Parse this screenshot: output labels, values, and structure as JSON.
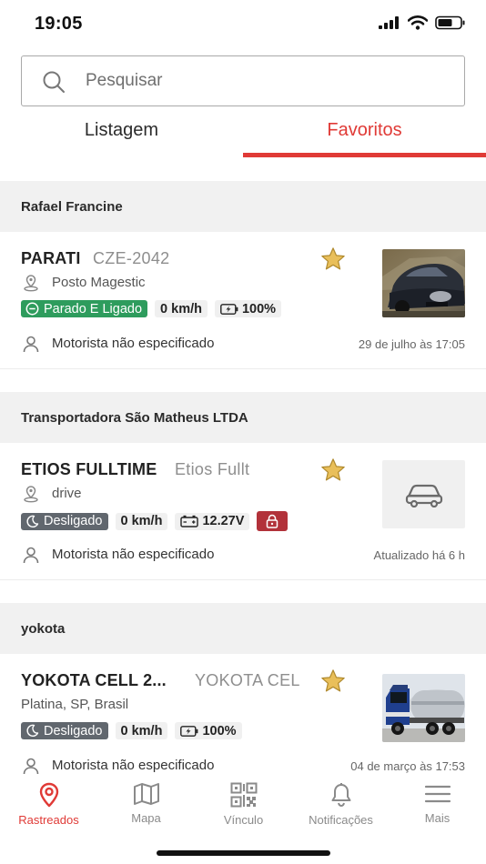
{
  "status_bar": {
    "time": "19:05"
  },
  "search": {
    "placeholder": "Pesquisar",
    "value": ""
  },
  "tabs": [
    {
      "label": "Listagem",
      "active": false
    },
    {
      "label": "Favoritos",
      "active": true
    }
  ],
  "colors": {
    "accent": "#e03a36",
    "status_on": "#2e9c5d",
    "status_off": "#61676e",
    "lock": "#b2323a",
    "star": "#e9bf5a"
  },
  "groups": [
    {
      "name": "Rafael Francine",
      "vehicle": {
        "name": "PARATI",
        "plate": "CZE-2042",
        "favorite": true,
        "location": "Posto Magestic",
        "status": "Parado E Ligado",
        "status_icon": "minus-circle-icon",
        "speed": "0 km/h",
        "power_icon": "battery-charge-icon",
        "power": "100%",
        "locked": false,
        "driver": "Motorista não especificado",
        "timestamp": "29 de julho às 17:05",
        "thumbnail": "car-photo"
      }
    },
    {
      "name": "Transportadora São Matheus LTDA",
      "vehicle": {
        "name": "ETIOS FULLTIME",
        "plate": "Etios Fullt",
        "favorite": true,
        "location": "drive",
        "status": "Desligado",
        "status_icon": "moon-icon",
        "speed": "0 km/h",
        "power_icon": "car-battery-icon",
        "power": "12.27V",
        "locked": true,
        "driver": "Motorista não especificado",
        "timestamp": "Atualizado há 6 h",
        "thumbnail": "car-placeholder-icon"
      }
    },
    {
      "name": "yokota",
      "vehicle": {
        "name": "YOKOTA CELL 2...",
        "plate": "YOKOTA CEL",
        "favorite": true,
        "location": "Platina, SP, Brasil",
        "status": "Desligado",
        "status_icon": "moon-icon",
        "speed": "0 km/h",
        "power_icon": "battery-charge-icon",
        "power": "100%",
        "locked": false,
        "driver": "Motorista não especificado",
        "timestamp": "04 de março às 17:53",
        "thumbnail": "truck-photo"
      }
    }
  ],
  "bottom_nav": [
    {
      "label": "Rastreados",
      "icon": "map-pin-icon",
      "active": true
    },
    {
      "label": "Mapa",
      "icon": "map-icon",
      "active": false
    },
    {
      "label": "Vínculo",
      "icon": "qr-code-icon",
      "active": false
    },
    {
      "label": "Notificações",
      "icon": "bell-icon",
      "active": false
    },
    {
      "label": "Mais",
      "icon": "menu-icon",
      "active": false
    }
  ]
}
